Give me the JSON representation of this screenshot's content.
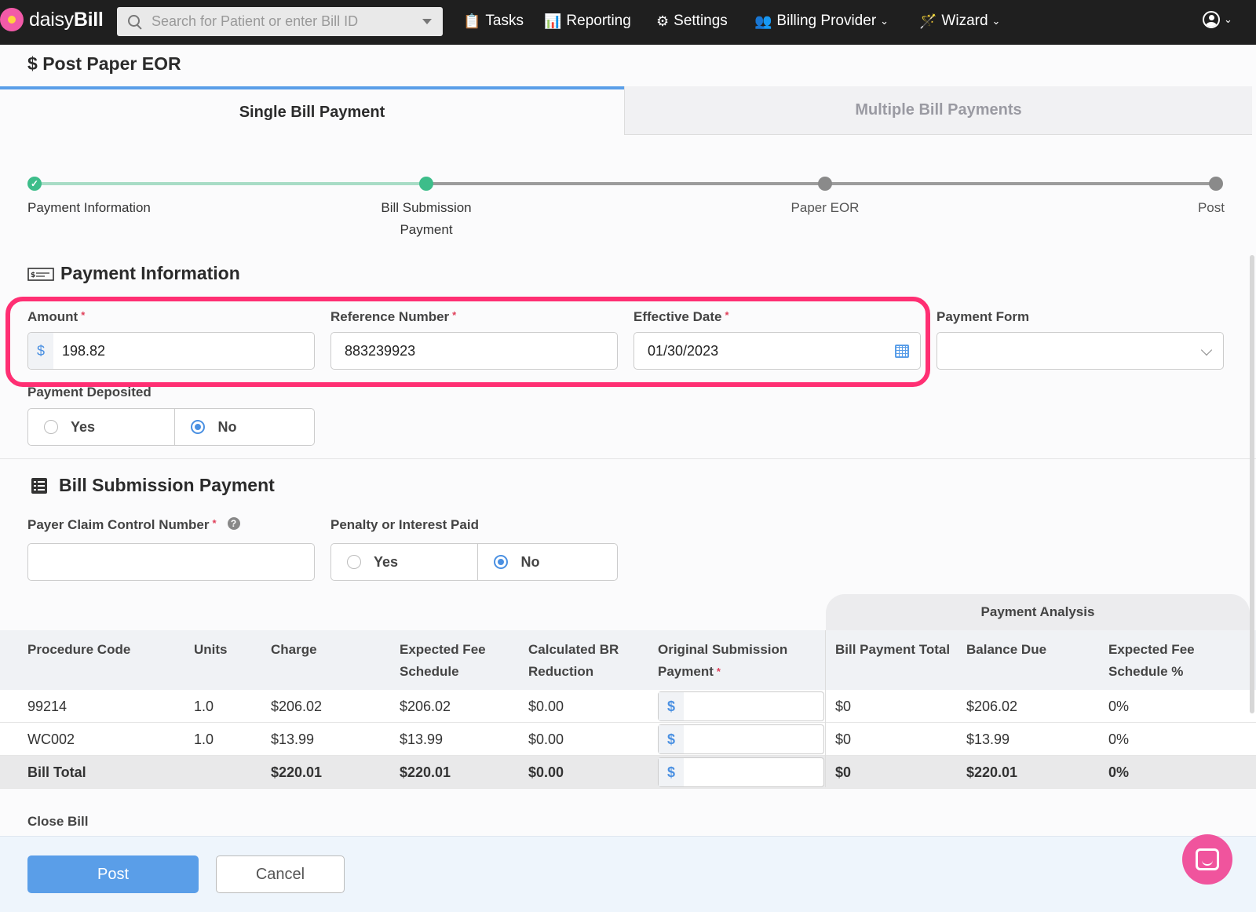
{
  "app": {
    "logo_prefix": "daisy",
    "logo_suffix": "Bill"
  },
  "search": {
    "placeholder": "Search for Patient or enter Bill ID"
  },
  "nav": {
    "tasks": "Tasks",
    "reporting": "Reporting",
    "settings": "Settings",
    "billing_provider": "Billing Provider",
    "wizard": "Wizard"
  },
  "page": {
    "title": "Post Paper EOR",
    "title_symbol": "$"
  },
  "tabs": {
    "single": "Single Bill Payment",
    "multiple": "Multiple Bill Payments"
  },
  "steps": [
    {
      "label": "Payment Information",
      "state": "complete"
    },
    {
      "label_line1": "Bill Submission",
      "label_line2": "Payment",
      "state": "current"
    },
    {
      "label": "Paper EOR",
      "state": "pending"
    },
    {
      "label": "Post",
      "state": "pending"
    }
  ],
  "payment_info": {
    "title": "Payment Information",
    "amount": {
      "label": "Amount",
      "required": "*",
      "prefix": "$",
      "value": "198.82"
    },
    "reference": {
      "label": "Reference Number",
      "required": "*",
      "value": "883239923"
    },
    "effective_date": {
      "label": "Effective Date",
      "required": "*",
      "value": "01/30/2023"
    },
    "payment_form": {
      "label": "Payment Form",
      "value": ""
    },
    "deposited": {
      "label": "Payment Deposited",
      "yes": "Yes",
      "no": "No",
      "selected": "No"
    }
  },
  "bill_submission": {
    "title": "Bill Submission Payment",
    "pccn": {
      "label": "Payer Claim Control Number",
      "required": "*",
      "help": "?",
      "value": ""
    },
    "penalty": {
      "label": "Penalty or Interest Paid",
      "yes": "Yes",
      "no": "No",
      "selected": "No"
    }
  },
  "table": {
    "analysis_header": "Payment Analysis",
    "headers": {
      "procedure": "Procedure Code",
      "units": "Units",
      "charge": "Charge",
      "efs_1": "Expected Fee",
      "efs_2": "Schedule",
      "br_1": "Calculated BR",
      "br_2": "Reduction",
      "osp_1": "Original Submission",
      "osp_2": "Payment",
      "osp_req": "*",
      "bpt": "Bill Payment Total",
      "balance": "Balance Due",
      "efsp_1": "Expected Fee",
      "efsp_2": "Schedule %"
    },
    "rows": [
      {
        "code": "99214",
        "units": "1.0",
        "charge": "$206.02",
        "efs": "$206.02",
        "br": "$0.00",
        "prefix": "$",
        "bpt": "$0",
        "balance": "$206.02",
        "pct": "0%"
      },
      {
        "code": "WC002",
        "units": "1.0",
        "charge": "$13.99",
        "efs": "$13.99",
        "br": "$0.00",
        "prefix": "$",
        "bpt": "$0",
        "balance": "$13.99",
        "pct": "0%"
      }
    ],
    "total": {
      "code": "Bill Total",
      "charge": "$220.01",
      "efs": "$220.01",
      "br": "$0.00",
      "prefix": "$",
      "bpt": "$0",
      "balance": "$220.01",
      "pct": "0%"
    }
  },
  "close_bill": "Close Bill",
  "footer": {
    "post": "Post",
    "cancel": "Cancel"
  },
  "colors": {
    "accent": "#5a9ee8",
    "highlight": "#ff2f73",
    "step_done": "#3dbd8a",
    "brand": "#f25aa8"
  },
  "icons": {
    "chat": "chat-icon",
    "user": "user-circle-icon",
    "calendar": "calendar-icon"
  }
}
